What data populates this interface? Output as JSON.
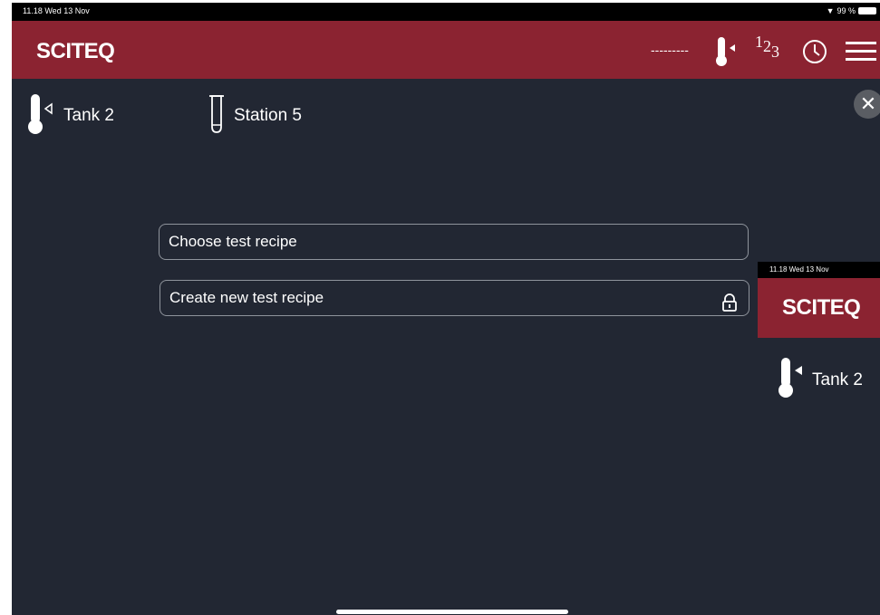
{
  "status": {
    "time": "11.18  Wed 13 Nov",
    "battery": "99 %"
  },
  "header": {
    "logo": "SCITEQ",
    "dashes": "---------",
    "digit1": "1",
    "digit2": "2",
    "digit3": "3"
  },
  "selection": {
    "tank": "Tank 2",
    "station": "Station 5"
  },
  "form": {
    "choose_label": "Choose test recipe",
    "create_label": "Create new test recipe"
  },
  "overlay": {
    "time": "11.18  Wed 13 Nov",
    "logo": "SCITEQ",
    "tank": "Tank 2"
  },
  "colors": {
    "header": "#8b2331",
    "background": "#222733"
  },
  "icons": [
    "thermometer-icon",
    "digits-icon",
    "clock-icon",
    "menu-icon",
    "tube-icon",
    "close-icon",
    "lock-icon"
  ]
}
